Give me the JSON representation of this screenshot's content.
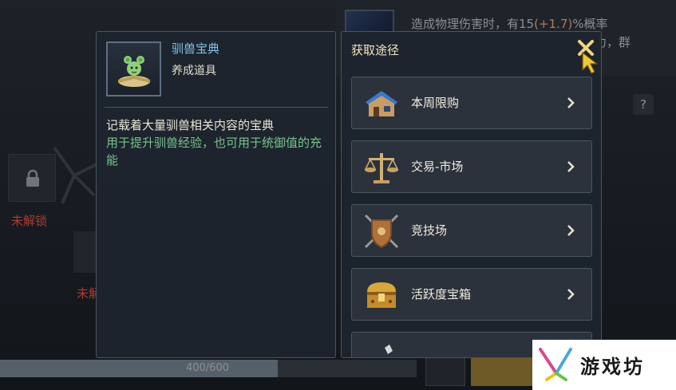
{
  "background": {
    "top_text_line1_prefix": "造成物理伤害时，有15",
    "top_text_line1_hl": "(+1.7)",
    "top_text_line1_suffix": "%概率",
    "top_text_line2": "力，群",
    "help_label": "?",
    "lock_label_1": "未解锁",
    "lock_label_2": "未解",
    "progress_text": "400/600",
    "progress_fraction": 0.667
  },
  "item": {
    "name": "驯兽宝典",
    "type": "养成道具",
    "description": "记载着大量驯兽相关内容的宝典",
    "usage": "用于提升驯兽经验，也可用于统御值的充能"
  },
  "sources": {
    "title": "获取途径",
    "items": [
      {
        "label": "本周限购",
        "icon": "shop-house-icon"
      },
      {
        "label": "交易-市场",
        "icon": "scales-icon"
      },
      {
        "label": "竞技场",
        "icon": "shield-swords-icon"
      },
      {
        "label": "活跃度宝箱",
        "icon": "treasure-chest-icon"
      }
    ]
  },
  "watermark": {
    "text": "游戏坊"
  },
  "colors": {
    "item_name": "#7fc3e8",
    "usage_text": "#79c38d",
    "locked_text": "#b23a2e",
    "close_x": "#f0d480"
  }
}
